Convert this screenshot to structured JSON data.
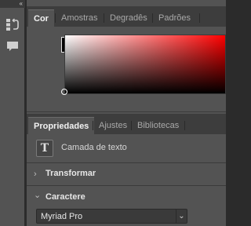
{
  "left_strip": {
    "collapse_icon": "«",
    "tools": [
      {
        "name": "history-icon"
      },
      {
        "name": "comment-icon"
      }
    ]
  },
  "color_panel": {
    "tabs": [
      {
        "label": "Cor",
        "active": true
      },
      {
        "label": "Amostras",
        "active": false
      },
      {
        "label": "Degradês",
        "active": false
      },
      {
        "label": "Padrões",
        "active": false
      }
    ],
    "foreground_color": "#000000",
    "background_color": "#ffffff",
    "hue_color": "#ff0000"
  },
  "properties_panel": {
    "tabs": [
      {
        "label": "Propriedades",
        "active": true
      },
      {
        "label": "Ajustes",
        "active": false
      },
      {
        "label": "Bibliotecas",
        "active": false
      }
    ],
    "layer_type_label": "Camada de texto",
    "sections": [
      {
        "title": "Transformar",
        "expanded": false,
        "chevron": "›"
      },
      {
        "title": "Caractere",
        "expanded": true,
        "chevron": "⌄"
      }
    ],
    "font_family": {
      "value": "Myriad Pro",
      "dropdown_glyph": "⌄"
    }
  }
}
